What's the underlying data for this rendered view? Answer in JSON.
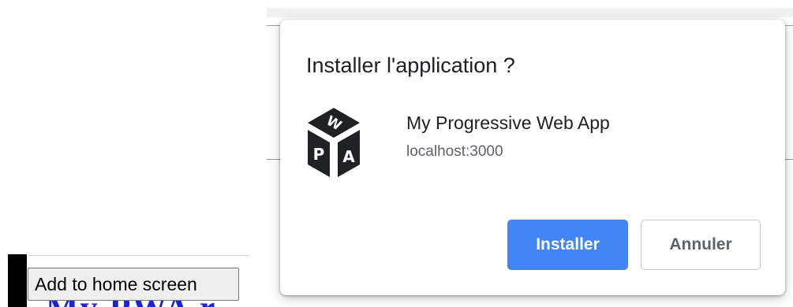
{
  "background": {
    "add_home_button_label": "Add to home screen",
    "heading_fragment": "My PWA r"
  },
  "install_dialog": {
    "title": "Installer l'application ?",
    "app_name": "My Progressive Web App",
    "app_origin": "localhost:3000",
    "install_label": "Installer",
    "cancel_label": "Annuler",
    "logo_letters": [
      "W",
      "P",
      "A"
    ],
    "colors": {
      "primary": "#4285f4",
      "logo": "#202124"
    }
  }
}
